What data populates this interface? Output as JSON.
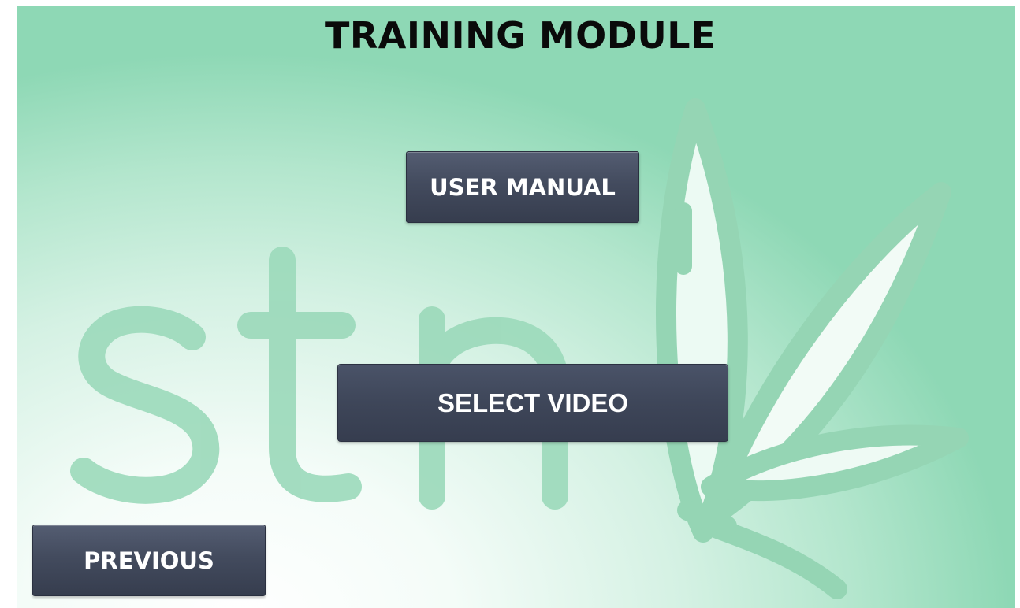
{
  "screen": {
    "title": "TRAINING MODULE",
    "watermark_logo": "stm"
  },
  "buttons": {
    "user_manual": "USER MANUAL",
    "select_video": "SELECT VIDEO",
    "previous": "PREVIOUS"
  },
  "colors": {
    "background_accent": "#8ed8b5",
    "watermark": "#9bd9ba",
    "button_fill": "#434b5e",
    "button_text": "#ffffff",
    "title_text": "#0a0a0a"
  },
  "icons": {
    "watermark": "stm-leaf-logo"
  }
}
